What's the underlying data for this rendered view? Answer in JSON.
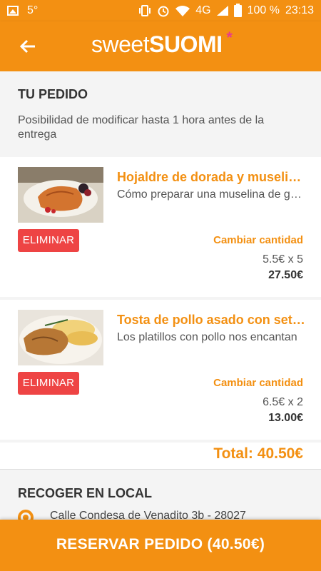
{
  "status_bar": {
    "notification_badge": "5°",
    "network": "4G",
    "battery": "100 %",
    "time": "23:13"
  },
  "app_bar": {
    "logo_part1": "sweet",
    "logo_part2": "SUOMI",
    "logo_mark": "*",
    "back_icon": "arrow-left-icon",
    "brand_color": "#f39012"
  },
  "order": {
    "title": "TU PEDIDO",
    "notice": "Posibilidad de modificar hasta 1 hora antes de la entrega"
  },
  "items": [
    {
      "title": "Hojaldre de dorada y muselina de gambas",
      "description": "Cómo preparar una muselina de gambas",
      "delete_label": "ELIMINAR",
      "change_label": "Cambiar cantidad",
      "unit_price": "5.5€ x 5",
      "subtotal": "27.50€"
    },
    {
      "title": "Tosta de pollo asado con setas",
      "description": "Los platillos con pollo nos encantan",
      "delete_label": "ELIMINAR",
      "change_label": "Cambiar cantidad",
      "unit_price": "6.5€ x 2",
      "subtotal": "13.00€"
    }
  ],
  "total": "Total: 40.50€",
  "pickup": {
    "title": "RECOGER EN LOCAL",
    "address": "Calle Condesa de Venadito 3b - 28027"
  },
  "reserve_button": "RESERVAR PEDIDO (40.50€)",
  "colors": {
    "accent": "#f39012",
    "delete": "#ee4444",
    "logo_mark": "#e83c8c"
  }
}
